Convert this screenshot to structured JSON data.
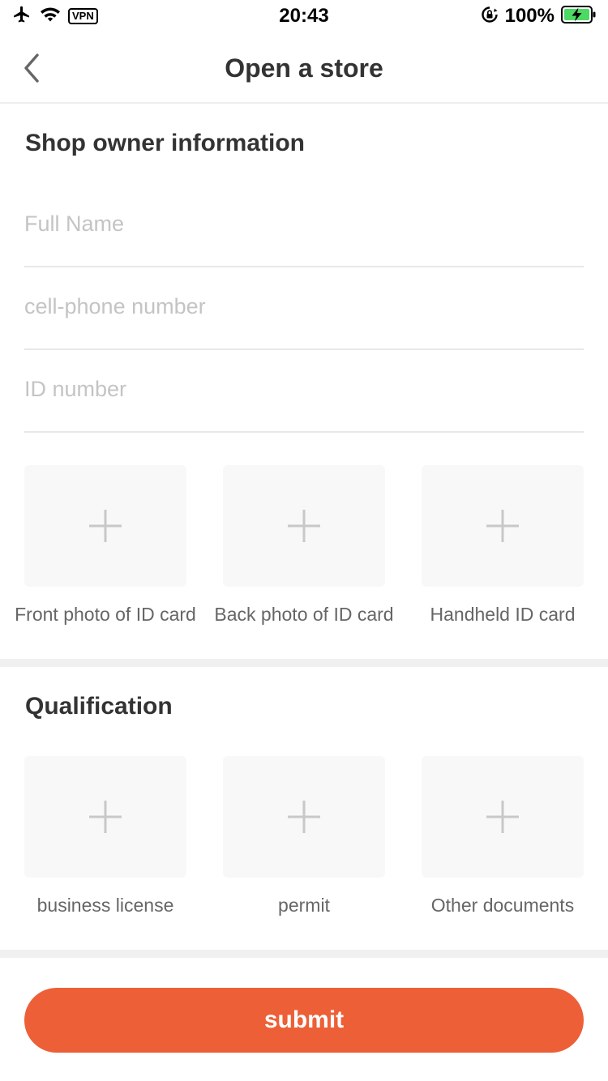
{
  "status_bar": {
    "time": "20:43",
    "vpn_label": "VPN",
    "battery_percent": "100%",
    "icons": [
      "airplane-icon",
      "wifi-icon",
      "rotation-lock-icon",
      "battery-charging-icon"
    ]
  },
  "nav": {
    "title": "Open a store",
    "back_icon": "chevron-left-icon"
  },
  "owner_section": {
    "title": "Shop owner information",
    "fields": [
      {
        "placeholder": "Full Name",
        "value": ""
      },
      {
        "placeholder": "cell-phone number",
        "value": ""
      },
      {
        "placeholder": "ID number",
        "value": ""
      }
    ],
    "uploads": [
      {
        "label": "Front photo of ID card",
        "icon": "plus-icon"
      },
      {
        "label": "Back photo of ID card",
        "icon": "plus-icon"
      },
      {
        "label": "Handheld ID card",
        "icon": "plus-icon"
      }
    ]
  },
  "qualification_section": {
    "title": "Qualification",
    "uploads": [
      {
        "label": "business license",
        "icon": "plus-icon"
      },
      {
        "label": "permit",
        "icon": "plus-icon"
      },
      {
        "label": "Other documents",
        "icon": "plus-icon"
      }
    ]
  },
  "submit": {
    "label": "submit"
  },
  "colors": {
    "accent": "#ed5f36",
    "upload_bg": "#f8f8f8",
    "divider": "#f0f0f0",
    "battery_fill": "#4cd964"
  }
}
